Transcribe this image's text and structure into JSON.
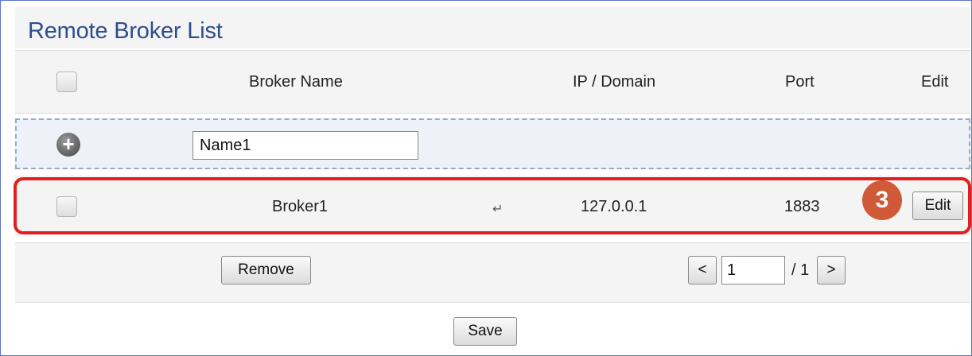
{
  "panel": {
    "title": "Remote Broker List"
  },
  "table": {
    "headers": {
      "broker_name": "Broker Name",
      "ip_domain": "IP / Domain",
      "port": "Port",
      "edit": "Edit"
    }
  },
  "add_row": {
    "name_value": "Name1",
    "add_icon": "plus-circle-icon"
  },
  "brokers": [
    {
      "name": "Broker1",
      "ip": "127.0.0.1",
      "port": "1883",
      "edit_label": "Edit",
      "mark": "↵"
    }
  ],
  "annotation": {
    "step": "3",
    "highlight_color": "#e0201e",
    "badge_color": "#d05a38"
  },
  "footer": {
    "remove_label": "Remove",
    "prev_label": "<",
    "page_value": "1",
    "page_total": "/ 1",
    "next_label": ">"
  },
  "save_label": "Save",
  "colors": {
    "title": "#2e4e8c",
    "border": "#5b72c8",
    "add_row_bg": "#eef2f8"
  }
}
